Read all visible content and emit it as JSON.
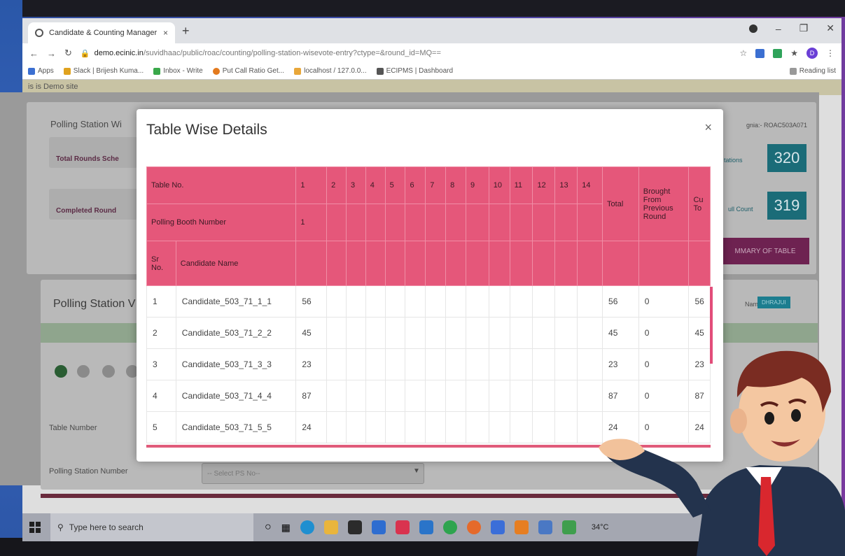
{
  "browser": {
    "tab_title": "Candidate & Counting Manager",
    "tab_close": "×",
    "new_tab": "+",
    "url_domain": "demo.ecinic.in",
    "url_path": "/suvidhaac/public/roac/counting/polling-station-wisevote-entry?ctype=&round_id=MQ==",
    "profile_initial": "D",
    "bookmarks": [
      "Apps",
      "Slack | Brijesh Kuma...",
      "Inbox - Write",
      "Put Call Ratio Get...",
      "localhost / 127.0.0...",
      "ECIPMS | Dashboard"
    ],
    "reading_list": "Reading list"
  },
  "page": {
    "demo_banner": "is is Demo site",
    "section_title": "Polling Station Wi",
    "total_rounds_label": "Total Rounds Sche",
    "completed_rounds_label": "Completed Round",
    "right_login": "gnia:- ROAC503A071",
    "stations_label": "tations",
    "stations_value": "320",
    "full_count_label": "ull Count",
    "full_count_value": "319",
    "summary_button": "MMARY OF TABLE",
    "polling_station_heading": "Polling Station V",
    "name_label": "Name",
    "name_badge": "DHRAJUI",
    "table_number_label": "Table Number",
    "ps_number_label": "Polling Station Number",
    "select_ps": "-- Select PS No--"
  },
  "modal": {
    "title": "Table Wise Details",
    "close": "×",
    "header": {
      "table_no_label": "Table No.",
      "polling_booth_label": "Polling Booth Number",
      "sr_no_label": "Sr No.",
      "candidate_name_label": "Candidate Name",
      "table_numbers": [
        "1",
        "2",
        "3",
        "4",
        "5",
        "6",
        "7",
        "8",
        "9",
        "10",
        "11",
        "12",
        "13",
        "14"
      ],
      "booth_numbers": [
        "1"
      ],
      "total_label": "Total",
      "brought_label": "Brought From Previous Round",
      "cut_label": "Cu To"
    },
    "rows": [
      {
        "sr": "1",
        "name": "Candidate_503_71_1_1",
        "t1": "56",
        "total": "56",
        "brought": "0",
        "cum": "56"
      },
      {
        "sr": "2",
        "name": "Candidate_503_71_2_2",
        "t1": "45",
        "total": "45",
        "brought": "0",
        "cum": "45"
      },
      {
        "sr": "3",
        "name": "Candidate_503_71_3_3",
        "t1": "23",
        "total": "23",
        "brought": "0",
        "cum": "23"
      },
      {
        "sr": "4",
        "name": "Candidate_503_71_4_4",
        "t1": "87",
        "total": "87",
        "brought": "0",
        "cum": "87"
      },
      {
        "sr": "5",
        "name": "Candidate_503_71_5_5",
        "t1": "24",
        "total": "24",
        "brought": "0",
        "cum": "24"
      }
    ]
  },
  "taskbar": {
    "search_placeholder": "Type here to search",
    "weather": "34°C"
  },
  "colors": {
    "table_header": "#e5577a",
    "stat_box": "#1b6c78",
    "summary_button": "#6e2251"
  }
}
